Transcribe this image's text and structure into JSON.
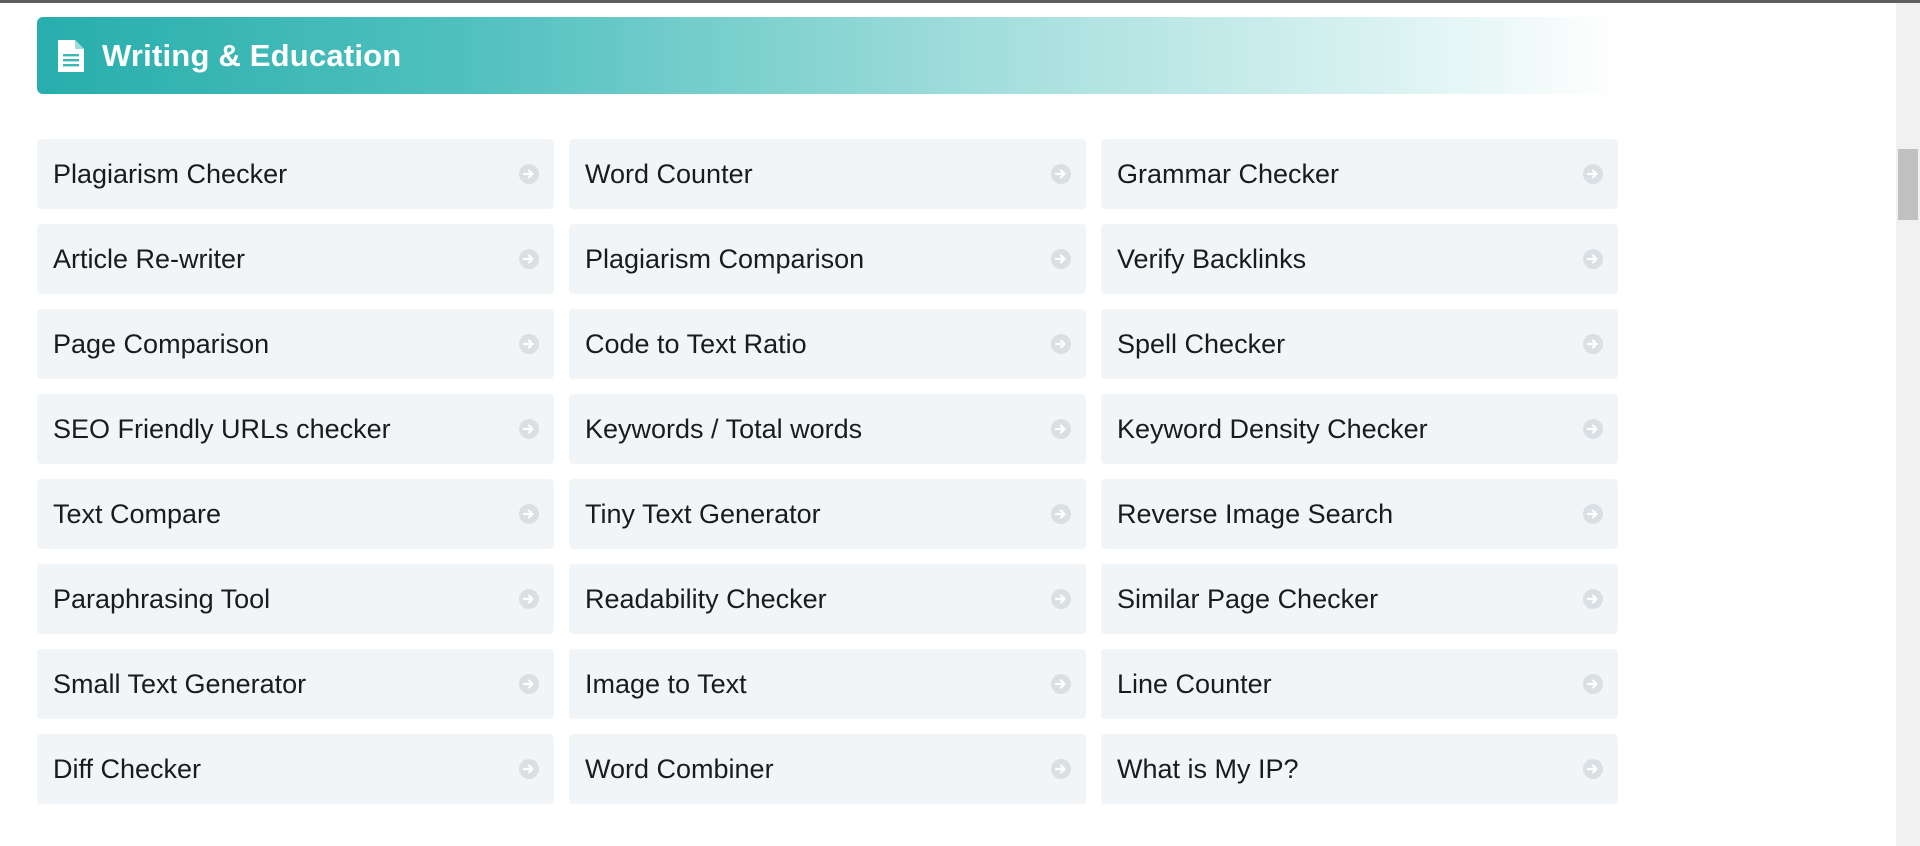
{
  "section": {
    "title": "Writing & Education",
    "icon": "document-icon"
  },
  "colors": {
    "header_start": "#27aeac",
    "header_end": "#ffffff",
    "card_bg": "#f1f5f7",
    "arrow": "#d9dfe3"
  },
  "tools": [
    {
      "label": "Plagiarism Checker"
    },
    {
      "label": "Word Counter"
    },
    {
      "label": "Grammar Checker"
    },
    {
      "label": "Article Re-writer"
    },
    {
      "label": "Plagiarism Comparison"
    },
    {
      "label": "Verify Backlinks"
    },
    {
      "label": "Page Comparison"
    },
    {
      "label": "Code to Text Ratio"
    },
    {
      "label": "Spell Checker"
    },
    {
      "label": "SEO Friendly URLs checker"
    },
    {
      "label": "Keywords / Total words"
    },
    {
      "label": "Keyword Density Checker"
    },
    {
      "label": "Text Compare"
    },
    {
      "label": "Tiny Text Generator"
    },
    {
      "label": "Reverse Image Search"
    },
    {
      "label": "Paraphrasing Tool"
    },
    {
      "label": "Readability Checker"
    },
    {
      "label": "Similar Page Checker"
    },
    {
      "label": "Small Text Generator"
    },
    {
      "label": "Image to Text"
    },
    {
      "label": "Line Counter"
    },
    {
      "label": "Diff Checker"
    },
    {
      "label": "Word Combiner"
    },
    {
      "label": "What is My IP?"
    }
  ]
}
